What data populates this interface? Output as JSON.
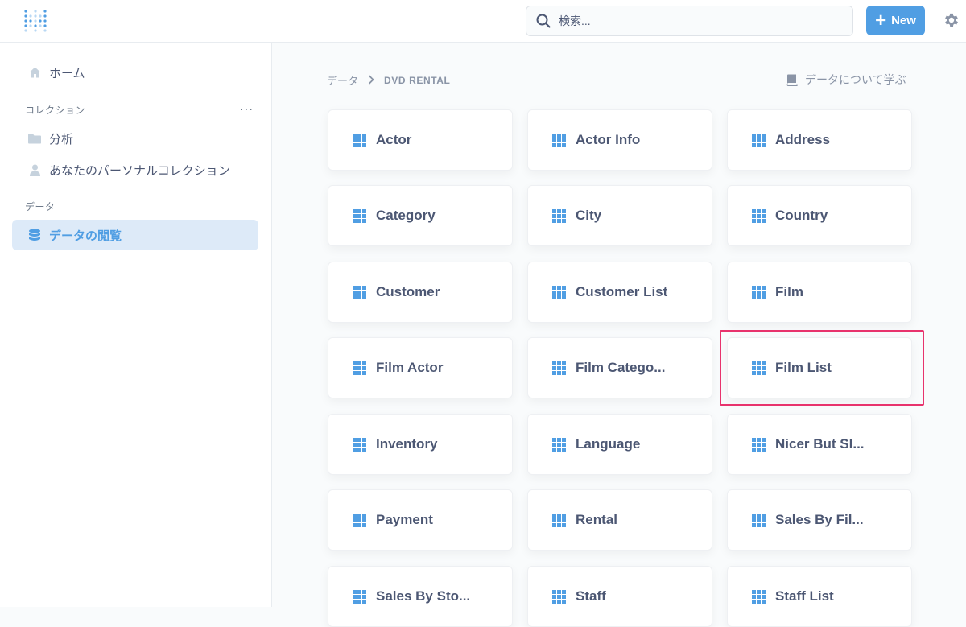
{
  "topbar": {
    "logo_icon": "metabase-logo-icon",
    "search_placeholder": "検索...",
    "new_button_label": "New",
    "brand_color": "#509ee3"
  },
  "sidebar": {
    "home_label": "ホーム",
    "collections_heading": "コレクション",
    "collections_menu": "···",
    "collections": [
      {
        "label": "分析",
        "icon": "folder-icon"
      },
      {
        "label": "あなたのパーソナルコレクション",
        "icon": "person-icon"
      }
    ],
    "data_heading": "データ",
    "browse_data_label": "データの閲覧"
  },
  "breadcrumb": {
    "root": "データ",
    "database": "DVD RENTAL"
  },
  "learn_link": "データについて学ぶ",
  "tables": [
    "Actor",
    "Actor Info",
    "Address",
    "Category",
    "City",
    "Country",
    "Customer",
    "Customer List",
    "Film",
    "Film Actor",
    "Film Catego...",
    "Film List",
    "Inventory",
    "Language",
    "Nicer But Sl...",
    "Payment",
    "Rental",
    "Sales By Fil...",
    "Sales By Sto...",
    "Staff",
    "Staff List"
  ],
  "highlighted_table": "Film List",
  "highlight_color": "#e8336d"
}
